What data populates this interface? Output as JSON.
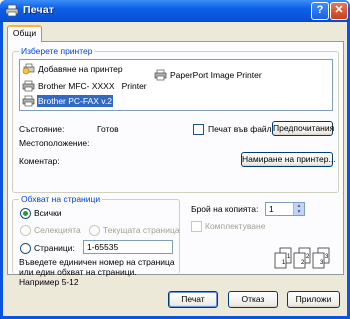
{
  "window": {
    "title": "Печат",
    "help_label": "?",
    "close_label": "✕"
  },
  "tabs": [
    {
      "label": "Общи",
      "active": true
    }
  ],
  "printer_group": {
    "label": "Изберете принтер",
    "printers": [
      {
        "name": "Добавяне на принтер",
        "icon": "add-printer-icon",
        "selected": false
      },
      {
        "name": "PaperPort Image Printer",
        "icon": "printer-icon",
        "selected": false
      },
      {
        "name": "Brother MFC- XXXX   Printer",
        "icon": "printer-icon",
        "selected": false
      },
      {
        "name": "Brother PC-FAX v.2",
        "icon": "fax-printer-icon",
        "selected": true
      }
    ],
    "status_label": "Състояние:",
    "status_value": "Готов",
    "location_label": "Местоположение:",
    "location_value": "",
    "comment_label": "Коментар:",
    "comment_value": "",
    "print_to_file_label": "Печат във файл",
    "print_to_file_checked": false,
    "preferences_button": "Предпочитания",
    "find_printer_button": "Намиране на принтер..."
  },
  "page_range_group": {
    "label": "Обхват на страници",
    "options": {
      "all": "Всички",
      "selection": "Селекцията",
      "current_page": "Текущата страница",
      "pages": "Страници:"
    },
    "selected_option": "all",
    "pages_value": "1-65535",
    "hint": "Въведете единичен номер на страница или един обхват на страници. Например 5-12"
  },
  "copies": {
    "label": "Брой на копията:",
    "value": "1",
    "collate_label": "Комплектуване",
    "collate_checked": false,
    "collate_pages": [
      "1",
      "1",
      "2",
      "2",
      "3",
      "3"
    ]
  },
  "footer": {
    "print_button": "Печат",
    "cancel_button": "Отказ",
    "apply_button": "Приложи"
  },
  "colors": {
    "titlebar": "#0a5fe8",
    "group_label": "#0046d5",
    "selection": "#316ac5",
    "dialog_bg": "#ece9d8"
  }
}
